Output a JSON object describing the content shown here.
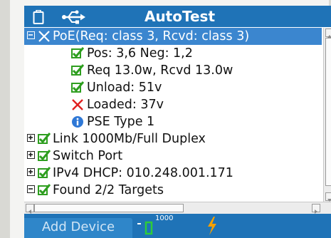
{
  "title_bar": {
    "title": "AutoTest",
    "battery_icon": "battery-icon",
    "usb_icon": "usb-icon"
  },
  "tree": [
    {
      "label": "PoE(Req: class 3, Rcvd: class 3)",
      "expander": "minus",
      "icon": "fail-x-icon",
      "selected": true
    },
    {
      "label": "Pos: 3,6 Neg: 1,2",
      "icon": "pass-check-icon"
    },
    {
      "label": "Req 13.0w, Rcvd 13.0w",
      "icon": "pass-check-icon"
    },
    {
      "label": "Unload: 51v",
      "icon": "pass-check-icon"
    },
    {
      "label": "Loaded: 37v",
      "icon": "fail-x-icon"
    },
    {
      "label": "PSE Type 1",
      "icon": "info-icon"
    },
    {
      "label": "Link 1000Mb/Full Duplex",
      "expander": "plus",
      "icon": "pass-check-icon"
    },
    {
      "label": "Switch Port",
      "expander": "plus",
      "icon": "pass-check-icon"
    },
    {
      "label": "IPv4 DHCP: 010.248.001.171",
      "expander": "plus",
      "icon": "pass-check-icon"
    },
    {
      "label": "Found 2/2 Targets",
      "expander": "minus",
      "icon": "pass-check-icon"
    }
  ],
  "status_bar": {
    "add_device_label": "Add Device",
    "link_speed": "1000",
    "link_icon": "link-status-icon",
    "power_icon": "lightning-icon"
  },
  "colors": {
    "accent_blue": "#1f73b7",
    "selection_blue": "#3b86cf",
    "pass_green": "#2e9e1f",
    "fail_red": "#e02020",
    "info_blue": "#2f78d6",
    "lightning_orange": "#f5a000"
  }
}
